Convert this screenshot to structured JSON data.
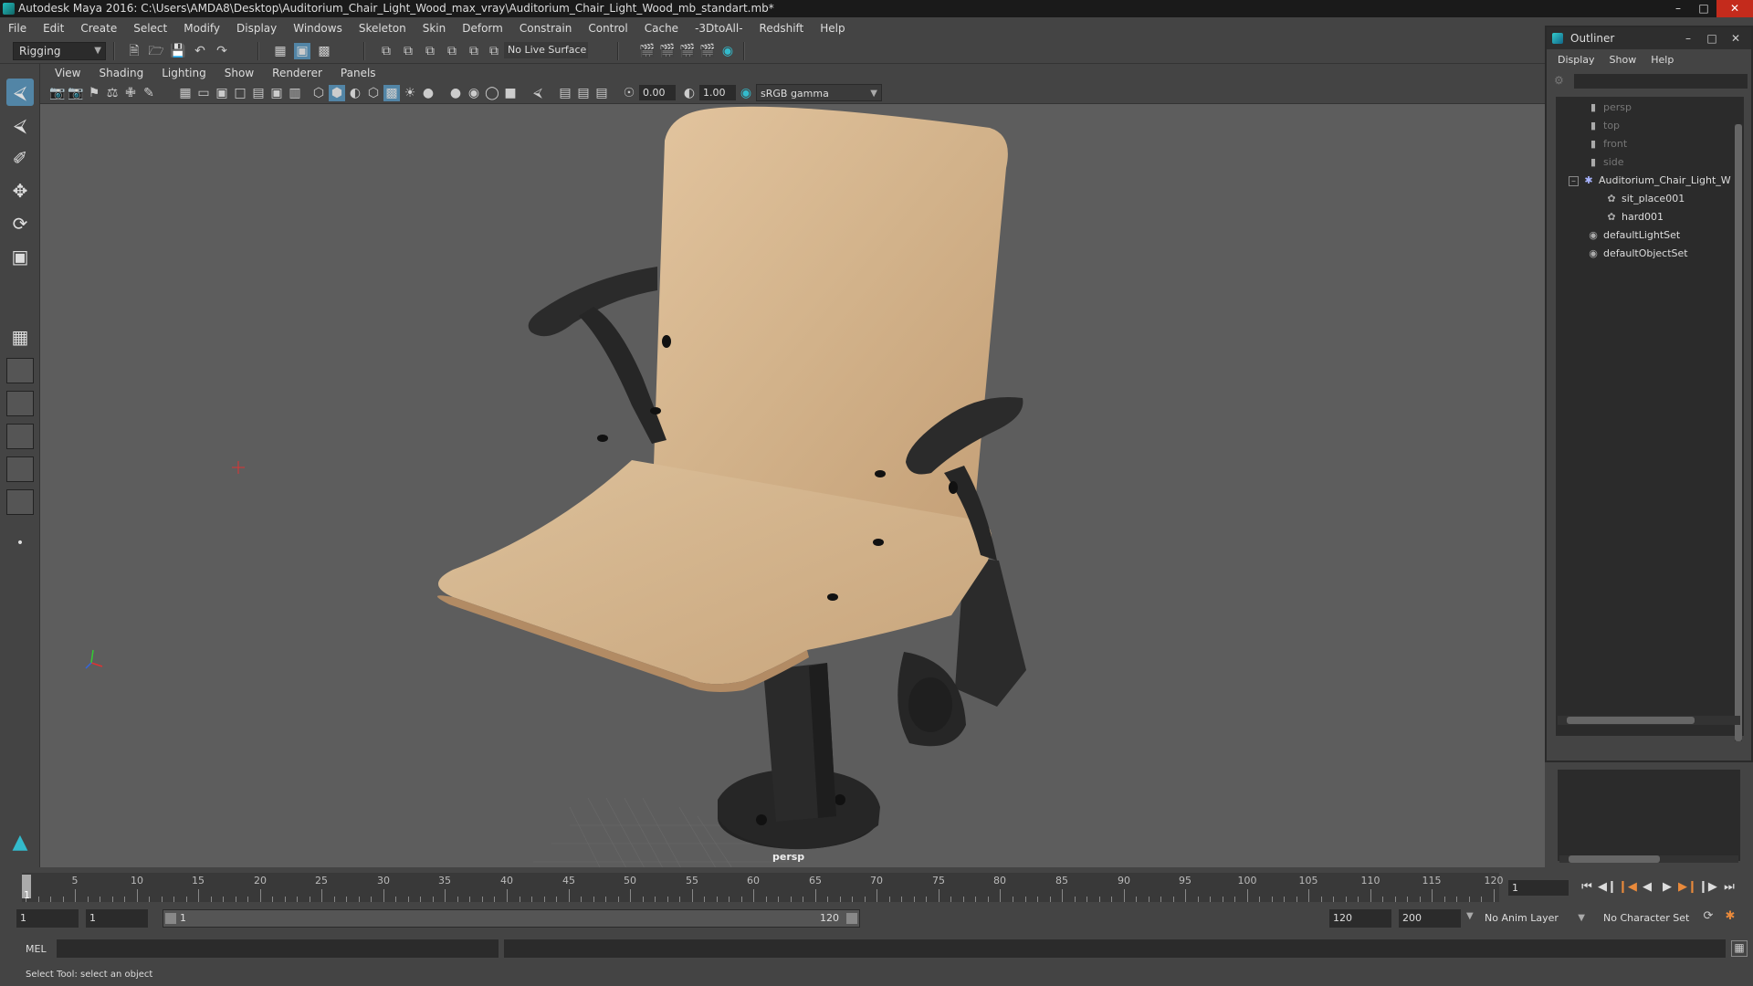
{
  "title": "Autodesk Maya 2016: C:\\Users\\AMDA8\\Desktop\\Auditorium_Chair_Light_Wood_max_vray\\Auditorium_Chair_Light_Wood_mb_standart.mb*",
  "menus": [
    "File",
    "Edit",
    "Create",
    "Select",
    "Modify",
    "Display",
    "Windows",
    "Skeleton",
    "Skin",
    "Deform",
    "Constrain",
    "Control",
    "Cache",
    "-3DtoAll-",
    "Redshift",
    "Help"
  ],
  "mode": "Rigging",
  "live_surface": "No Live Surface",
  "panel_menus": [
    "View",
    "Shading",
    "Lighting",
    "Show",
    "Renderer",
    "Panels"
  ],
  "panel_fields": {
    "exposure": "0.00",
    "gamma_value": "1.00",
    "color_space": "sRGB gamma"
  },
  "camera_label": "persp",
  "outliner": {
    "title": "Outliner",
    "menus": [
      "Display",
      "Show",
      "Help"
    ],
    "items": [
      {
        "label": "persp",
        "icon": "camera-icon",
        "dim": true
      },
      {
        "label": "top",
        "icon": "camera-icon",
        "dim": true
      },
      {
        "label": "front",
        "icon": "camera-icon",
        "dim": true
      },
      {
        "label": "side",
        "icon": "camera-icon",
        "dim": true
      },
      {
        "label": "Auditorium_Chair_Light_W",
        "icon": "group-icon",
        "dim": false
      },
      {
        "label": "sit_place001",
        "icon": "mesh-icon",
        "dim": false
      },
      {
        "label": "hard001",
        "icon": "mesh-icon",
        "dim": false
      },
      {
        "label": "defaultLightSet",
        "icon": "set-icon",
        "dim": false
      },
      {
        "label": "defaultObjectSet",
        "icon": "set-icon",
        "dim": false
      }
    ]
  },
  "timeline": {
    "ticks": [
      5,
      10,
      15,
      20,
      25,
      30,
      35,
      40,
      45,
      50,
      55,
      60,
      65,
      70,
      75,
      80,
      85,
      90,
      95,
      100,
      105,
      110,
      115,
      120
    ],
    "start_label": "1",
    "current_frame": "1"
  },
  "range": {
    "start": "1",
    "playback_start": "1",
    "slider_start": "1",
    "slider_end": "120",
    "playback_end": "120",
    "end": "200",
    "anim_layer": "No Anim Layer",
    "character_set": "No Character Set"
  },
  "cmd": {
    "label": "MEL",
    "help": "Select Tool: select an object"
  }
}
